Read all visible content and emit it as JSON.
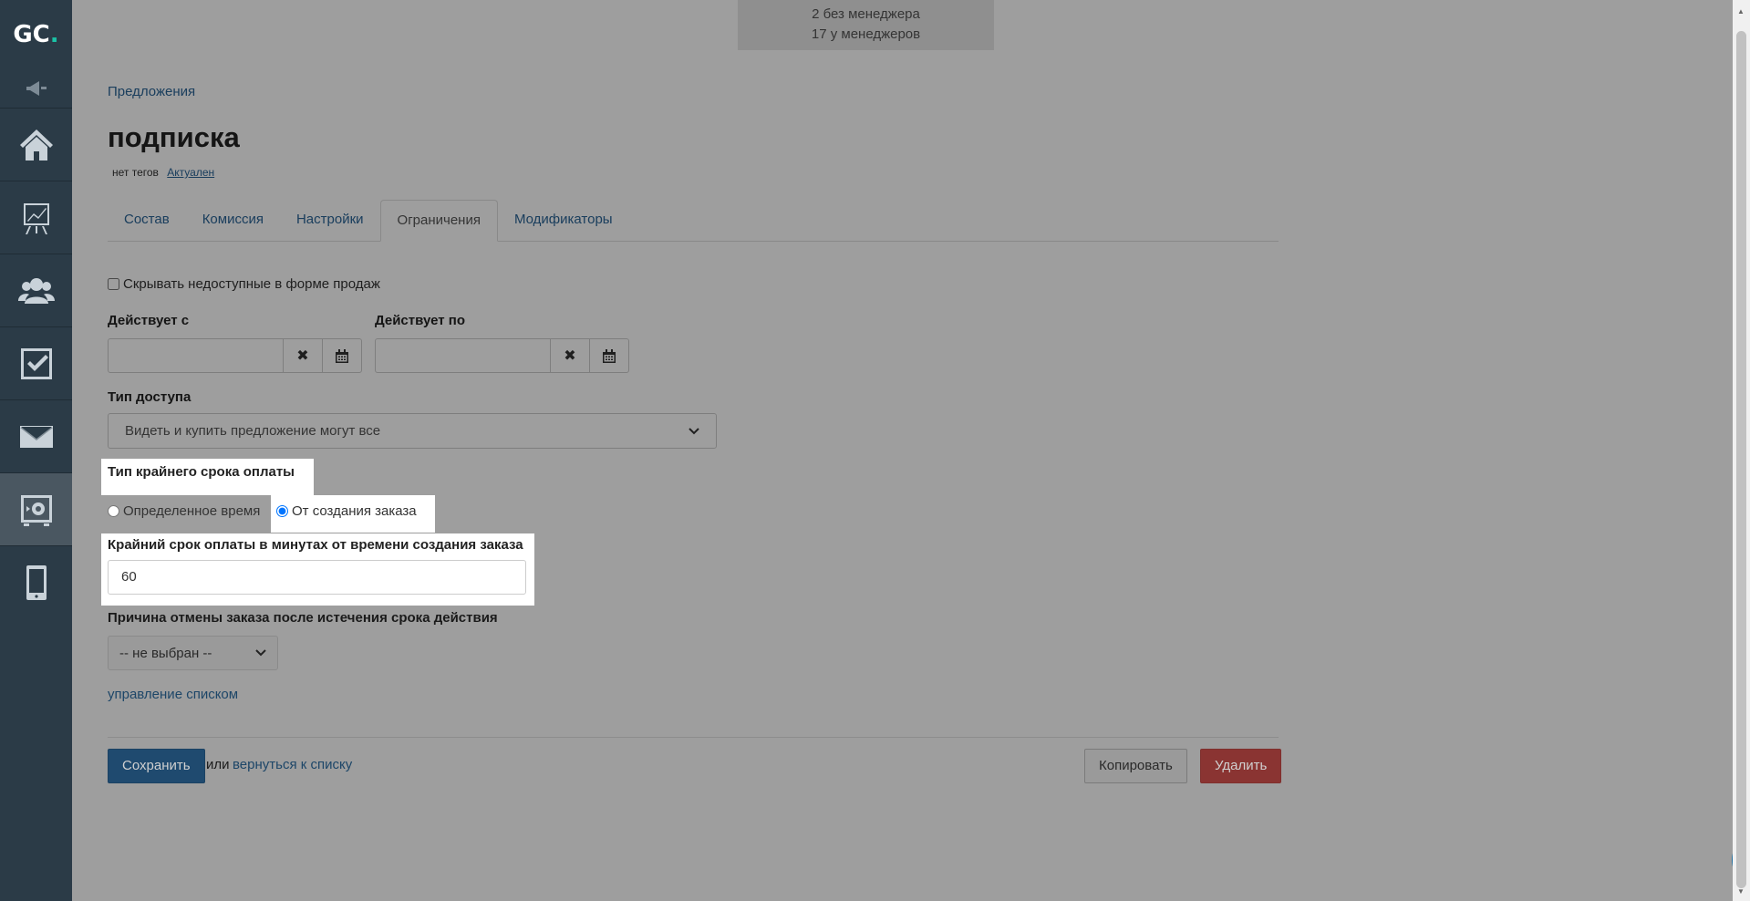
{
  "sidebar": {
    "logo_main": "GC",
    "logo_dot": ".",
    "collapse_icon": "megaphone-icon",
    "items": [
      {
        "icon": "home-icon"
      },
      {
        "icon": "chart-icon"
      },
      {
        "icon": "users-icon"
      },
      {
        "icon": "tasks-icon"
      },
      {
        "icon": "mail-icon"
      },
      {
        "icon": "sales-icon",
        "active": true
      },
      {
        "icon": "mobile-icon"
      }
    ]
  },
  "top_stats": {
    "line1": "2 без менеджера",
    "line2": "17 у менеджеров"
  },
  "breadcrumb": "Предложения",
  "page_title": "подписка",
  "tags": {
    "no_tags": "нет тегов",
    "status": "Актуален"
  },
  "tabs": [
    {
      "label": "Состав"
    },
    {
      "label": "Комиссия"
    },
    {
      "label": "Настройки"
    },
    {
      "label": "Ограничения",
      "active": true
    },
    {
      "label": "Модификаторы"
    }
  ],
  "form": {
    "hide_unavailable_label": "Скрывать недоступные в форме продаж",
    "valid_from_label": "Действует с",
    "valid_to_label": "Действует по",
    "access_type_label": "Тип доступа",
    "access_type_value": "Видеть и купить предложение могут все",
    "deadline_type_label": "Тип крайнего срока оплаты",
    "deadline_option_fixed": "Определенное время",
    "deadline_option_order": "От создания заказа",
    "deadline_minutes_label": "Крайний срок оплаты в минутах от времени создания заказа",
    "deadline_minutes_value": "60",
    "cancel_reason_label": "Причина отмены заказа после истечения срока действия",
    "cancel_reason_value": "-- не выбран --",
    "manage_list_link": "управление списком"
  },
  "actions": {
    "save": "Сохранить",
    "or": "или",
    "back_link": "вернуться к списку",
    "copy": "Копировать",
    "delete": "Удалить"
  }
}
